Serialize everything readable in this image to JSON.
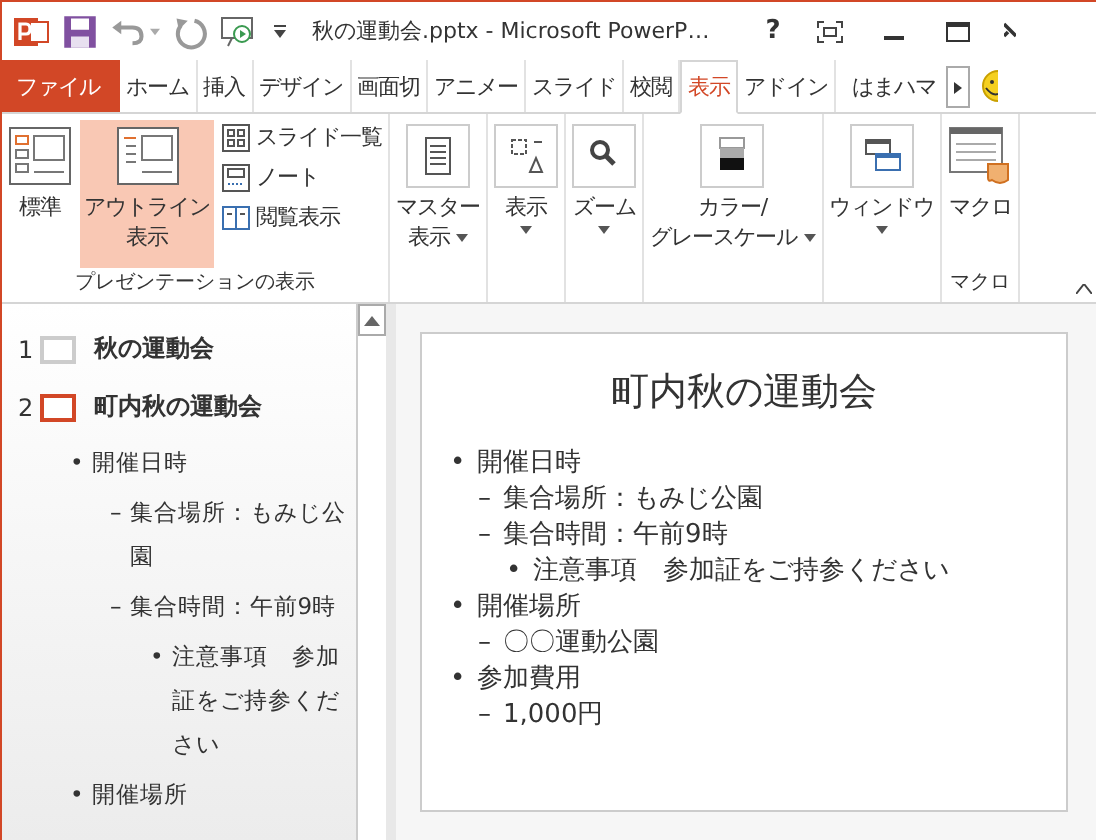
{
  "window": {
    "title": "秋の運動会.pptx - Microsoft PowerP…",
    "help": "?"
  },
  "file_tab": "ファイル",
  "tabs": [
    {
      "label": "ホーム",
      "selected": false
    },
    {
      "label": "挿入",
      "selected": false
    },
    {
      "label": "デザイン",
      "selected": false
    },
    {
      "label": "画面切",
      "selected": false
    },
    {
      "label": "アニメー",
      "selected": false
    },
    {
      "label": "スライド",
      "selected": false
    },
    {
      "label": "校閲",
      "selected": false
    },
    {
      "label": "表示",
      "selected": true
    },
    {
      "label": "アドイン",
      "selected": false
    }
  ],
  "user": "はまハマ",
  "ribbon": {
    "groups": [
      {
        "label": "プレゼンテーションの表示",
        "buttons": [
          {
            "lines": [
              "標準"
            ],
            "kind": "normal",
            "selected": false,
            "dropdown": false
          },
          {
            "lines": [
              "アウトライン",
              "表示"
            ],
            "kind": "outline",
            "selected": true,
            "dropdown": false
          }
        ],
        "small_buttons": [
          {
            "label": "スライド一覧",
            "kind": "sorter",
            "selected": false
          },
          {
            "label": "ノート",
            "kind": "notes",
            "selected": false
          },
          {
            "label": "閲覧表示",
            "kind": "reading",
            "selected": false
          }
        ]
      },
      {
        "buttons": [
          {
            "lines": [
              "マスター",
              "表示"
            ],
            "kind": "master",
            "selected": false,
            "dropdown": true
          }
        ]
      },
      {
        "buttons": [
          {
            "lines": [
              "表示"
            ],
            "kind": "show",
            "selected": false,
            "dropdown": true
          }
        ]
      },
      {
        "buttons": [
          {
            "lines": [
              "ズーム"
            ],
            "kind": "zoom",
            "selected": false,
            "dropdown": true
          }
        ]
      },
      {
        "buttons": [
          {
            "lines": [
              "カラー/",
              "グレースケール"
            ],
            "kind": "color",
            "selected": false,
            "dropdown": true
          }
        ]
      },
      {
        "buttons": [
          {
            "lines": [
              "ウィンドウ"
            ],
            "kind": "window",
            "selected": false,
            "dropdown": true
          }
        ]
      },
      {
        "label": "マクロ",
        "buttons": [
          {
            "lines": [
              "マクロ"
            ],
            "kind": "macro",
            "selected": false,
            "dropdown": false
          }
        ]
      }
    ]
  },
  "outline": [
    {
      "number": "1",
      "title": "秋の運動会",
      "selected": false
    },
    {
      "number": "2",
      "title": "町内秋の運動会",
      "selected": true,
      "children": [
        {
          "marker": "•",
          "text": "開催日時",
          "children": [
            {
              "marker": "–",
              "text": "集合場所：もみじ公園"
            },
            {
              "marker": "–",
              "text": "集合時間：午前9時",
              "children": [
                {
                  "marker": "•",
                  "text": "注意事項　参加証をご持参ください"
                }
              ]
            }
          ]
        },
        {
          "marker": "•",
          "text": "開催場所"
        }
      ]
    }
  ],
  "slide": {
    "title": "町内秋の運動会",
    "bullets": [
      {
        "marker": "•",
        "text": "開催日時",
        "children": [
          {
            "marker": "–",
            "text": "集合場所：もみじ公園"
          },
          {
            "marker": "–",
            "text": "集合時間：午前9時",
            "children": [
              {
                "marker": "•",
                "text": "注意事項　参加証をご持参ください"
              }
            ]
          }
        ]
      },
      {
        "marker": "•",
        "text": "開催場所",
        "children": [
          {
            "marker": "–",
            "text": "〇〇運動公園"
          }
        ]
      },
      {
        "marker": "•",
        "text": "参加費用",
        "children": [
          {
            "marker": "–",
            "text": "1,000円"
          }
        ]
      }
    ]
  }
}
